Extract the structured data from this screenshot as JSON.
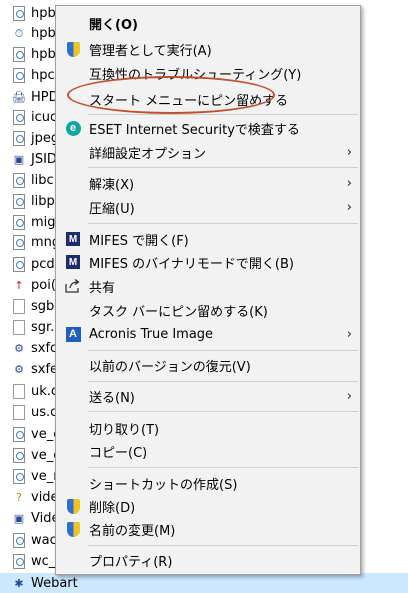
{
  "files": [
    {
      "name": "hpb",
      "icon": "document-icon"
    },
    {
      "name": "hpb",
      "icon": "clock-icon"
    },
    {
      "name": "hpb",
      "icon": "document-icon"
    },
    {
      "name": "hpc",
      "icon": "document-icon"
    },
    {
      "name": "HPD",
      "icon": "printer-icon"
    },
    {
      "name": "icuc",
      "icon": "document-icon"
    },
    {
      "name": "jpeg",
      "icon": "document-icon"
    },
    {
      "name": "JSID",
      "icon": "app-icon"
    },
    {
      "name": "libc",
      "icon": "document-icon"
    },
    {
      "name": "libp",
      "icon": "document-icon"
    },
    {
      "name": "mig",
      "icon": "document-icon"
    },
    {
      "name": "mng",
      "icon": "document-icon"
    },
    {
      "name": "pcd",
      "icon": "document-icon"
    },
    {
      "name": "poi(",
      "icon": "arrow-icon"
    },
    {
      "name": "sgb",
      "icon": "blank-file-icon"
    },
    {
      "name": "sgr.",
      "icon": "blank-file-icon"
    },
    {
      "name": "sxfc",
      "icon": "gear-icon"
    },
    {
      "name": "sxfe",
      "icon": "gear-icon"
    },
    {
      "name": "uk.c",
      "icon": "blank-file-icon"
    },
    {
      "name": "us.c",
      "icon": "blank-file-icon"
    },
    {
      "name": "ve_c",
      "icon": "document-icon"
    },
    {
      "name": "ve_c",
      "icon": "document-icon"
    },
    {
      "name": "ve_r",
      "icon": "document-icon"
    },
    {
      "name": "vide",
      "icon": "help-icon"
    },
    {
      "name": "Vide",
      "icon": "app-icon"
    },
    {
      "name": "wac",
      "icon": "document-icon"
    },
    {
      "name": "wc_",
      "icon": "document-icon"
    },
    {
      "name": "Webart",
      "icon": "webart-icon",
      "selected": true
    }
  ],
  "menu": {
    "open": "開く(O)",
    "run_as_admin": "管理者として実行(A)",
    "troubleshoot": "互換性のトラブルシューティング(Y)",
    "pin_start": "スタート メニューにピン留めする",
    "eset_scan": "ESET Internet Securityで検査する",
    "eset_advanced": "詳細設定オプション",
    "extract": "解凍(X)",
    "compress": "圧縮(U)",
    "mifes_open": "MIFES で開く(F)",
    "mifes_binary": "MIFES のバイナリモードで開く(B)",
    "share": "共有",
    "pin_taskbar": "タスク バーにピン留めする(K)",
    "acronis": "Acronis True Image",
    "restore_versions": "以前のバージョンの復元(V)",
    "send_to": "送る(N)",
    "cut": "切り取り(T)",
    "copy": "コピー(C)",
    "create_shortcut": "ショートカットの作成(S)",
    "delete": "削除(D)",
    "rename": "名前の変更(M)",
    "properties": "プロパティ(R)"
  },
  "icons": {
    "eset": "e",
    "mifes": "M",
    "acronis": "A",
    "submenu_arrow": "›"
  },
  "colors": {
    "highlight_ring": "#c0502c",
    "selection": "#cce8ff",
    "menu_bg": "#f2f2f2"
  }
}
